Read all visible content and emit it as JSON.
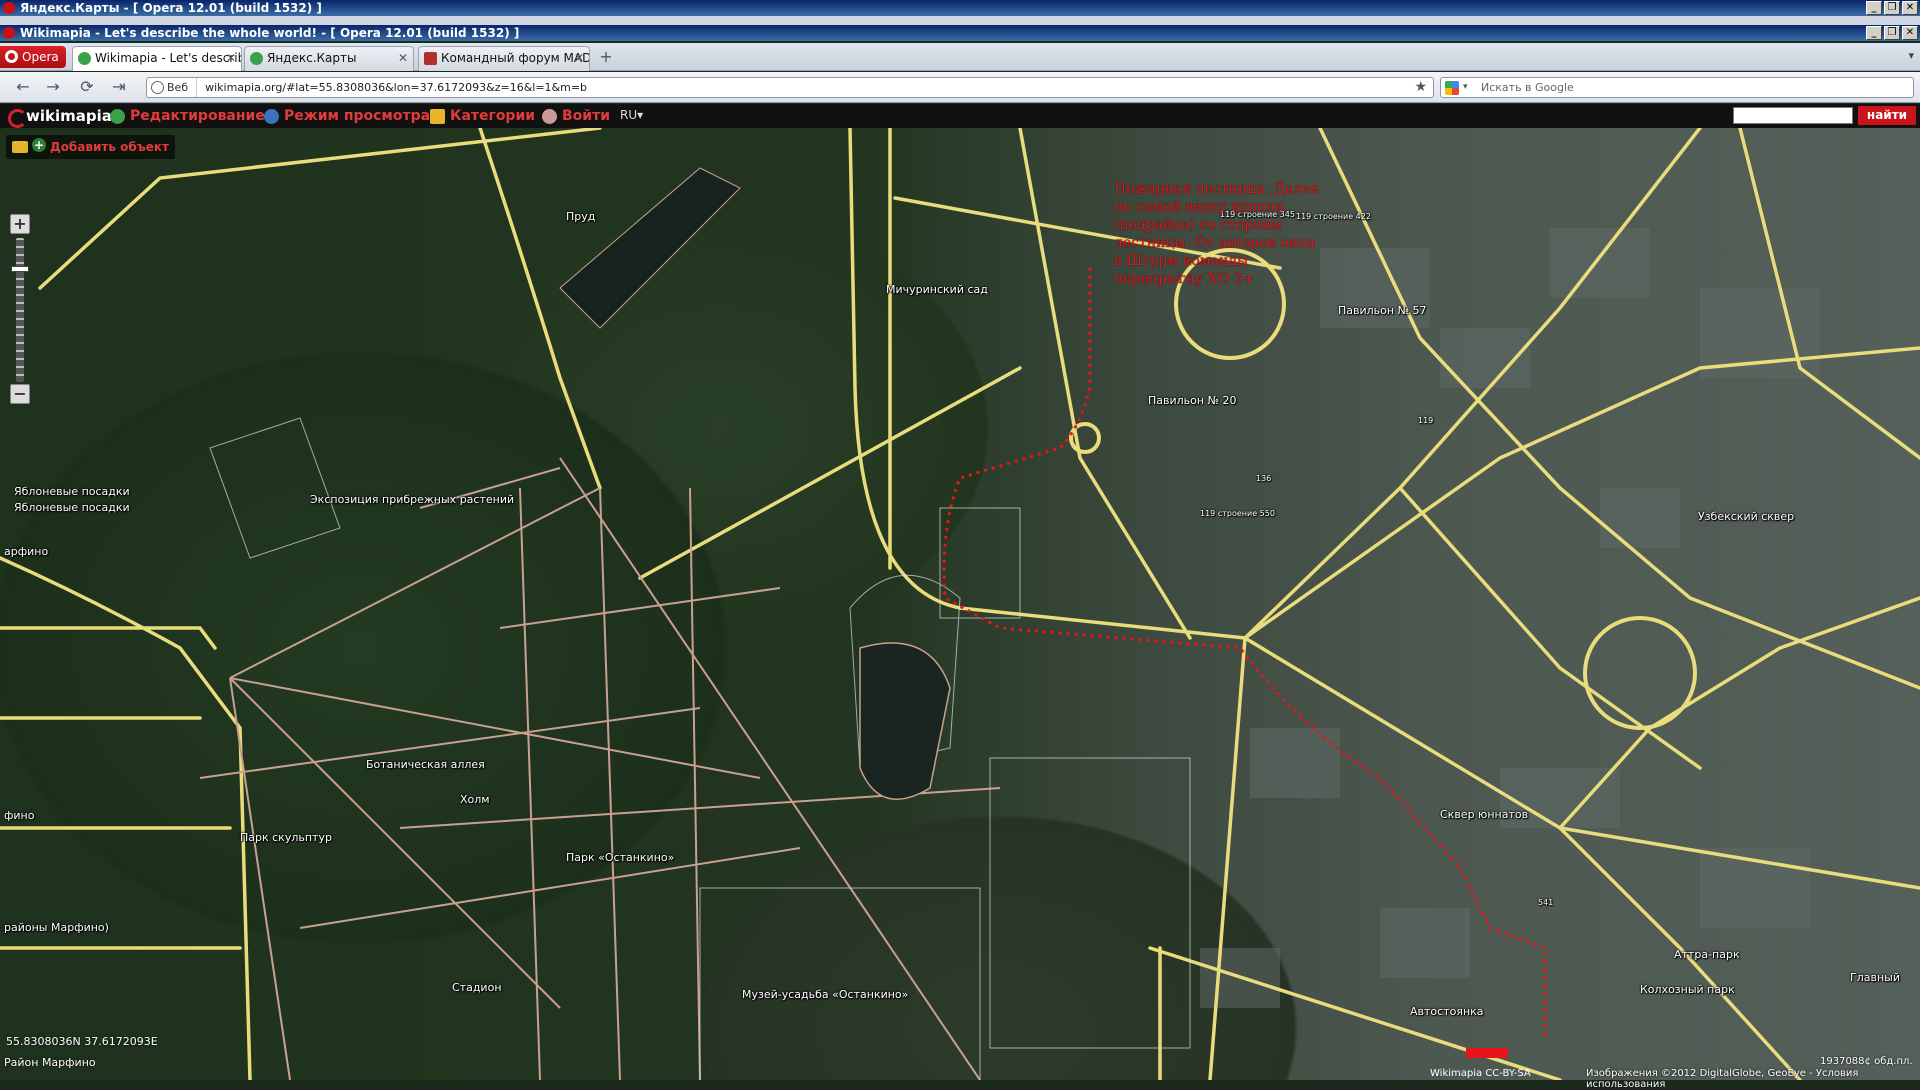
{
  "window_outer": {
    "title": "Яндекс.Карты - [ Opera 12.01 (build 1532) ]"
  },
  "window_inner": {
    "title": "Wikimapia - Let's describe the whole world! - [ Opera 12.01 (build 1532) ]"
  },
  "window_buttons": {
    "minimize": "_",
    "restore": "❐",
    "close": "✕"
  },
  "tabs": [
    {
      "label": "Wikimapia - Let's describ...",
      "active": true
    },
    {
      "label": "Яндекс.Карты",
      "active": false
    },
    {
      "label": "Командный форум MAD...",
      "active": false
    }
  ],
  "opera_menu": {
    "label": "Opera"
  },
  "nav": {
    "back": "←",
    "forward": "→",
    "reload": "⟳",
    "fastforward": "⇥",
    "web_label": "Веб",
    "url": "wikimapia.org/#lat=55.8308036&lon=37.6172093&z=16&l=1&m=b",
    "star": "★",
    "search_placeholder": "Искать в Google",
    "search_dropdown": "▾"
  },
  "wikimapia": {
    "logo": "wikimapia",
    "edit": "Редактирование",
    "view_mode": "Режим просмотра",
    "categories": "Категории",
    "login": "Войти",
    "lang": "RU▾",
    "find": "найти",
    "add_object": "Добавить объект",
    "zoom_in": "+",
    "zoom_out": "−"
  },
  "map_labels": {
    "prud": "Пруд",
    "michurinsky": "Мичуринский сад",
    "pavilion57": "Павильон № 57",
    "pavilion20": "Павильон № 20",
    "yablon1": "Яблоневые посадки",
    "yablon2": "Яблоневые посадки",
    "expo": "Экспозиция прибрежных растений",
    "arfino": "арфино",
    "uzbek": "Узбекский сквер",
    "botanic": "Ботаническая аллея",
    "holm": "Холм",
    "park_sculpt": "Парк скульптур",
    "park_ostankino": "Парк «Останкино»",
    "skver": "Сквер юннатов",
    "fino": "фино",
    "rayony": "районы Марфино)",
    "stadion": "Стадион",
    "museum": "Музей-усадьба «Останкино»",
    "avtostoyanka": "Автостоянка",
    "attra": "Аттра-парк",
    "kolhoz": "Колхозный парк",
    "glavny": "Главный",
    "b119_345": "119 строение 345",
    "b119_422": "119 строение 422",
    "b119_550": "119 строение 550",
    "n119": "119",
    "n136": "136",
    "n541": "541"
  },
  "annotation": "Пожарная лестница. Далее по самой верху купола (подрайка) со стороны лестницы. От авторов окон в Штурм команды перепрыгну ХО 3+",
  "status": {
    "coords": "55.8308036N 37.6172093E",
    "marfino": "Район Марфино",
    "copyright": "Изображения ©2012 DigitalGlobe, GeoEye - Условия использования",
    "license": "Wikimapia CC-BY-SA",
    "scale": "1937088¢ обд.пл."
  },
  "colors": {
    "road": "#e9dc7c",
    "path": "#c9a08f",
    "route": "#e8131b",
    "brand_red": "#d2202f"
  }
}
